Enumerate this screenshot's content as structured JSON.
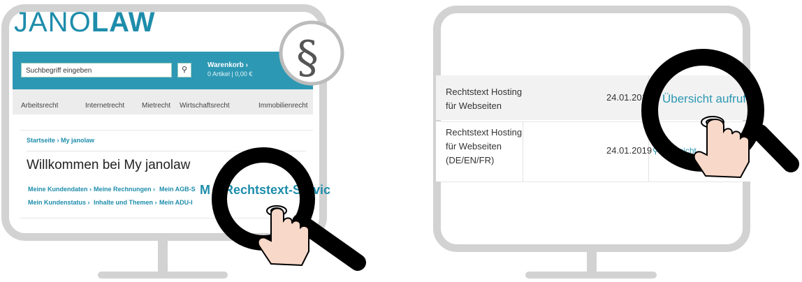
{
  "left_screen": {
    "logo": {
      "part1": "JANO",
      "part2": "LAW"
    },
    "search": {
      "placeholder": "Suchbegriff eingeben",
      "button_icon": "search-icon"
    },
    "cart": {
      "title": "Warenkorb ›",
      "subtitle": "0 Artikel | 0,00 €"
    },
    "nav_items": [
      "Arbeitsrecht",
      "Internetrecht",
      "Mietrecht",
      "Wirtschaftsrecht",
      "Immobilienrecht"
    ],
    "breadcrumb": "Startseite  › My janolaw",
    "welcome": "Willkommen bei My janolaw",
    "links_row1": [
      "Meine Kundendaten ›",
      "Meine Rechnungen ›",
      "Mein AGB-S"
    ],
    "links_row2": [
      "Mein Kundenstatus ›",
      "Inhalte und Themen ›",
      "Mein ADU-I"
    ],
    "highlight_link": "M    Rechtstext-Servic"
  },
  "right_screen": {
    "rows": [
      {
        "title_lines": [
          "Rechtstext Hosting",
          "für Webseiten"
        ],
        "date": "24.01.2019",
        "action": "Übersicht aufrufen"
      },
      {
        "title_lines": [
          "Rechtstext Hosting",
          "für Webseiten",
          "(DE/EN/FR)"
        ],
        "date": "24.01.2019",
        "action": "Übersicht"
      }
    ]
  },
  "icons": [
    "magnifier-icon",
    "pointing-hand-icon"
  ],
  "colors": {
    "brand": "#2d98b4",
    "monitor_frame": "#d2d2d2",
    "magnifier": "#000000",
    "hand": "#f8d8c8"
  }
}
